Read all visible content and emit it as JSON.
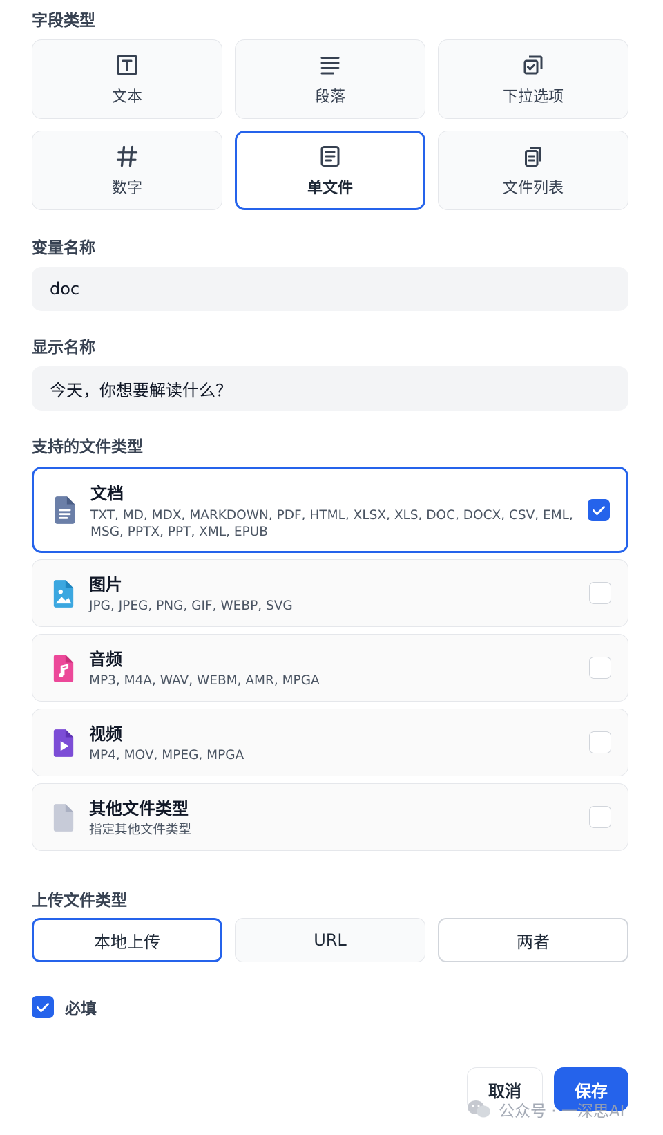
{
  "field_type": {
    "label": "字段类型",
    "options": [
      {
        "label": "文本",
        "icon": "text-box-icon"
      },
      {
        "label": "段落",
        "icon": "paragraph-lines-icon"
      },
      {
        "label": "下拉选项",
        "icon": "dropdown-check-icon"
      },
      {
        "label": "数字",
        "icon": "hash-icon"
      },
      {
        "label": "单文件",
        "icon": "single-file-icon",
        "selected": true
      },
      {
        "label": "文件列表",
        "icon": "file-list-icon"
      }
    ]
  },
  "variable_name": {
    "label": "变量名称",
    "value": "doc"
  },
  "display_name": {
    "label": "显示名称",
    "value": "今天，你想要解读什么？"
  },
  "file_types": {
    "label": "支持的文件类型",
    "options": [
      {
        "title": "文档",
        "desc": "TXT, MD, MDX, MARKDOWN, PDF, HTML, XLSX, XLS, DOC, DOCX, CSV, EML, MSG, PPTX, PPT, XML, EPUB",
        "icon": "document-icon",
        "checked": true
      },
      {
        "title": "图片",
        "desc": "JPG, JPEG, PNG, GIF, WEBP, SVG",
        "icon": "image-icon",
        "checked": false
      },
      {
        "title": "音频",
        "desc": "MP3, M4A, WAV, WEBM, AMR, MPGA",
        "icon": "audio-icon",
        "checked": false
      },
      {
        "title": "视频",
        "desc": "MP4, MOV, MPEG, MPGA",
        "icon": "video-icon",
        "checked": false
      },
      {
        "title": "其他文件类型",
        "desc": "指定其他文件类型",
        "icon": "other-file-icon",
        "checked": false
      }
    ]
  },
  "upload_type": {
    "label": "上传文件类型",
    "options": [
      {
        "label": "本地上传",
        "selected": true
      },
      {
        "label": "URL"
      },
      {
        "label": "两者"
      }
    ]
  },
  "required": {
    "label": "必填",
    "checked": true
  },
  "actions": {
    "cancel": "取消",
    "save": "保存"
  },
  "watermark": "公众号 · 一深思AI",
  "colors": {
    "accent": "#2563eb",
    "document_icon": "#6b7fa8",
    "image_icon": "#3ba7e0",
    "audio_icon": "#ec4899",
    "video_icon": "#7c4dd6",
    "other_icon": "#c7cbd8"
  }
}
